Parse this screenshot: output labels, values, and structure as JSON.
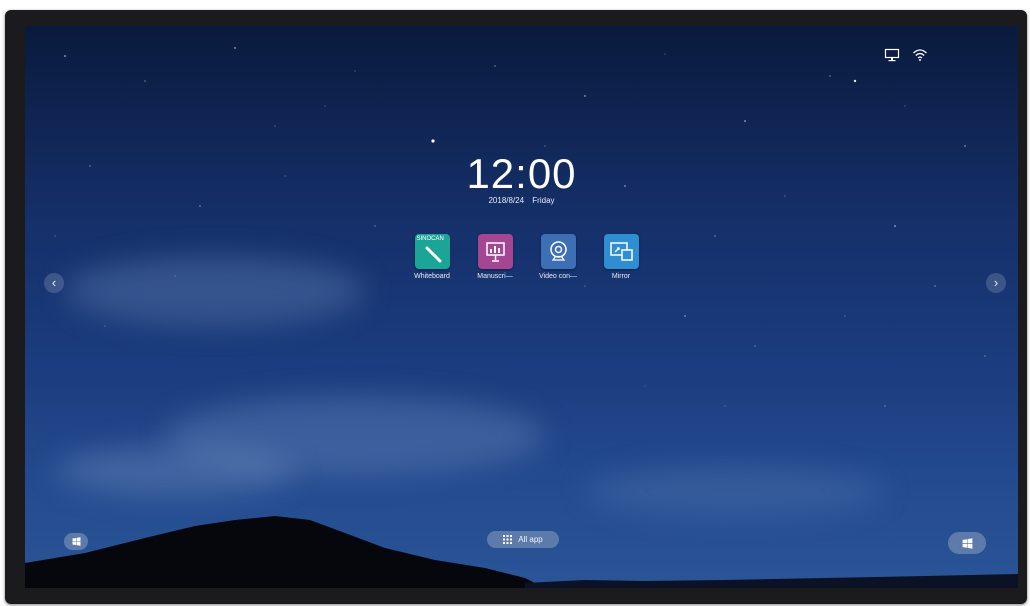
{
  "status_bar": {
    "display_icon": "monitor-icon",
    "wifi_icon": "wifi-icon"
  },
  "clock": {
    "time": "12:00",
    "date": "2018/8/24",
    "weekday": "Friday"
  },
  "apps": [
    {
      "label": "Whiteboard",
      "icon": "whiteboard-icon",
      "brand_text": "SINOCAN",
      "color": "#1aa597"
    },
    {
      "label": "Manuscri—",
      "icon": "presentation-icon",
      "color": "#a54693"
    },
    {
      "label": "Video con—",
      "icon": "webcam-icon",
      "color": "#3d6fb4"
    },
    {
      "label": "Mirror",
      "icon": "mirror-screen-icon",
      "color": "#2f8ed1"
    }
  ],
  "nav": {
    "prev_icon": "chevron-left-icon",
    "next_icon": "chevron-right-icon"
  },
  "dock": {
    "all_app_label": "All app",
    "all_app_icon": "grid-icon",
    "left_button_icon": "windows-icon",
    "right_button_icon": "windows-icon"
  }
}
